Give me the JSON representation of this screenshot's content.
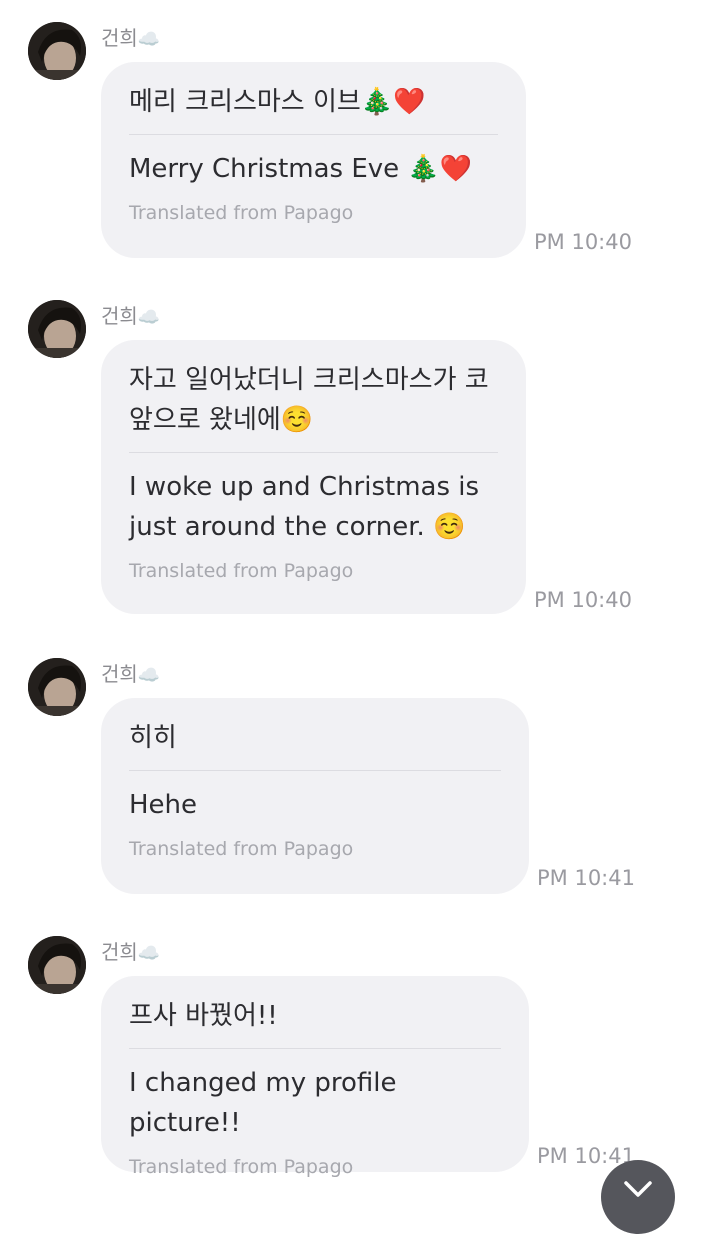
{
  "messages": [
    {
      "sender": "건희",
      "sender_badge": "☁️",
      "original": "메리 크리스마스 이브🎄❤️",
      "translated": "Merry Christmas Eve 🎄❤️",
      "credit": "Translated from Papago",
      "time": "PM 10:40"
    },
    {
      "sender": "건희",
      "sender_badge": "☁️",
      "original_lines": [
        "자고 일어났더니 크리스마스가 코",
        "앞으로 왔네에☺️"
      ],
      "translated_lines": [
        "I woke up and Christmas is",
        "just around the corner. ☺️"
      ],
      "credit": "Translated from Papago",
      "time": "PM 10:40"
    },
    {
      "sender": "건희",
      "sender_badge": "☁️",
      "original": "히히",
      "translated": "Hehe",
      "credit": "Translated from Papago",
      "time": "PM 10:41"
    },
    {
      "sender": "건희",
      "sender_badge": "☁️",
      "original": "프사 바꿨어!!",
      "translated": "I changed my profile picture!!",
      "credit": "Translated from Papago",
      "time": "PM 10:41"
    }
  ],
  "icons": {
    "avatar": "profile-photo",
    "scroll_down": "chevron-down-icon"
  },
  "colors": {
    "bubble": "#f1f1f4",
    "text": "#2c2c30",
    "muted": "#9a9aa0",
    "scroll_button": "#55565c"
  }
}
